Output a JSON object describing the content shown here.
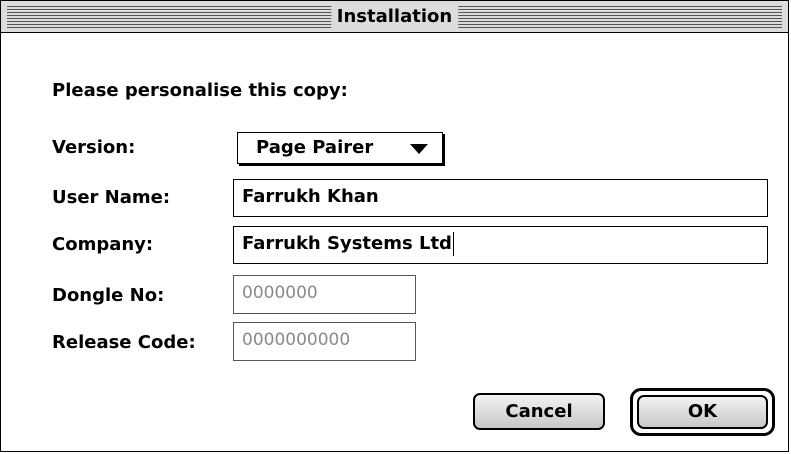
{
  "window": {
    "title": "Installation"
  },
  "form": {
    "heading": "Please personalise this copy:",
    "version": {
      "label": "Version:",
      "selected": "Page Pairer"
    },
    "user_name": {
      "label": "User Name:",
      "value": "Farrukh Khan"
    },
    "company": {
      "label": "Company:",
      "value": "Farrukh Systems Ltd"
    },
    "dongle": {
      "label": "Dongle No:",
      "placeholder": "0000000"
    },
    "release": {
      "label": "Release Code:",
      "placeholder": "0000000000"
    }
  },
  "buttons": {
    "cancel": "Cancel",
    "ok": "OK"
  }
}
